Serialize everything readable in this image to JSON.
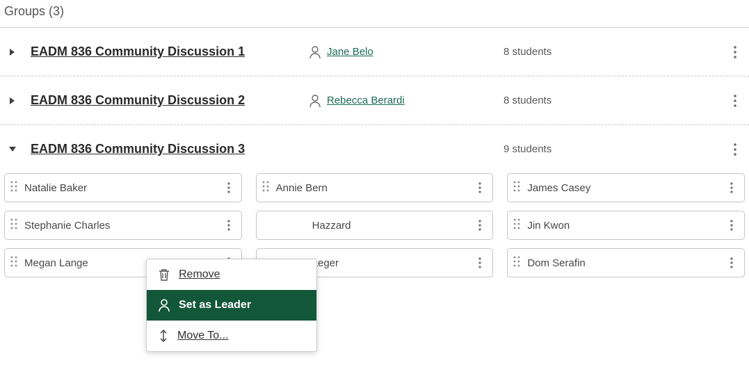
{
  "header": "Groups (3)",
  "groups": [
    {
      "title": "EADM 836 Community Discussion 1",
      "leader": "Jane Belo",
      "count": "8 students",
      "expanded": false
    },
    {
      "title": "EADM 836 Community Discussion 2",
      "leader": "Rebecca Berardi",
      "count": "8 students",
      "expanded": false
    },
    {
      "title": "EADM 836 Community Discussion 3",
      "leader": "",
      "count": "9 students",
      "expanded": true
    }
  ],
  "students": [
    {
      "name": "Natalie Baker"
    },
    {
      "name": "Annie Bern"
    },
    {
      "name": "James Casey"
    },
    {
      "name": "Stephanie Charles"
    },
    {
      "name": "Hazzard"
    },
    {
      "name": "Jin Kwon"
    },
    {
      "name": "Megan Lange"
    },
    {
      "name": "aeger"
    },
    {
      "name": "Dom Serafin"
    }
  ],
  "menu": {
    "remove": "Remove",
    "set_leader": "Set as Leader",
    "move": "Move To..."
  }
}
